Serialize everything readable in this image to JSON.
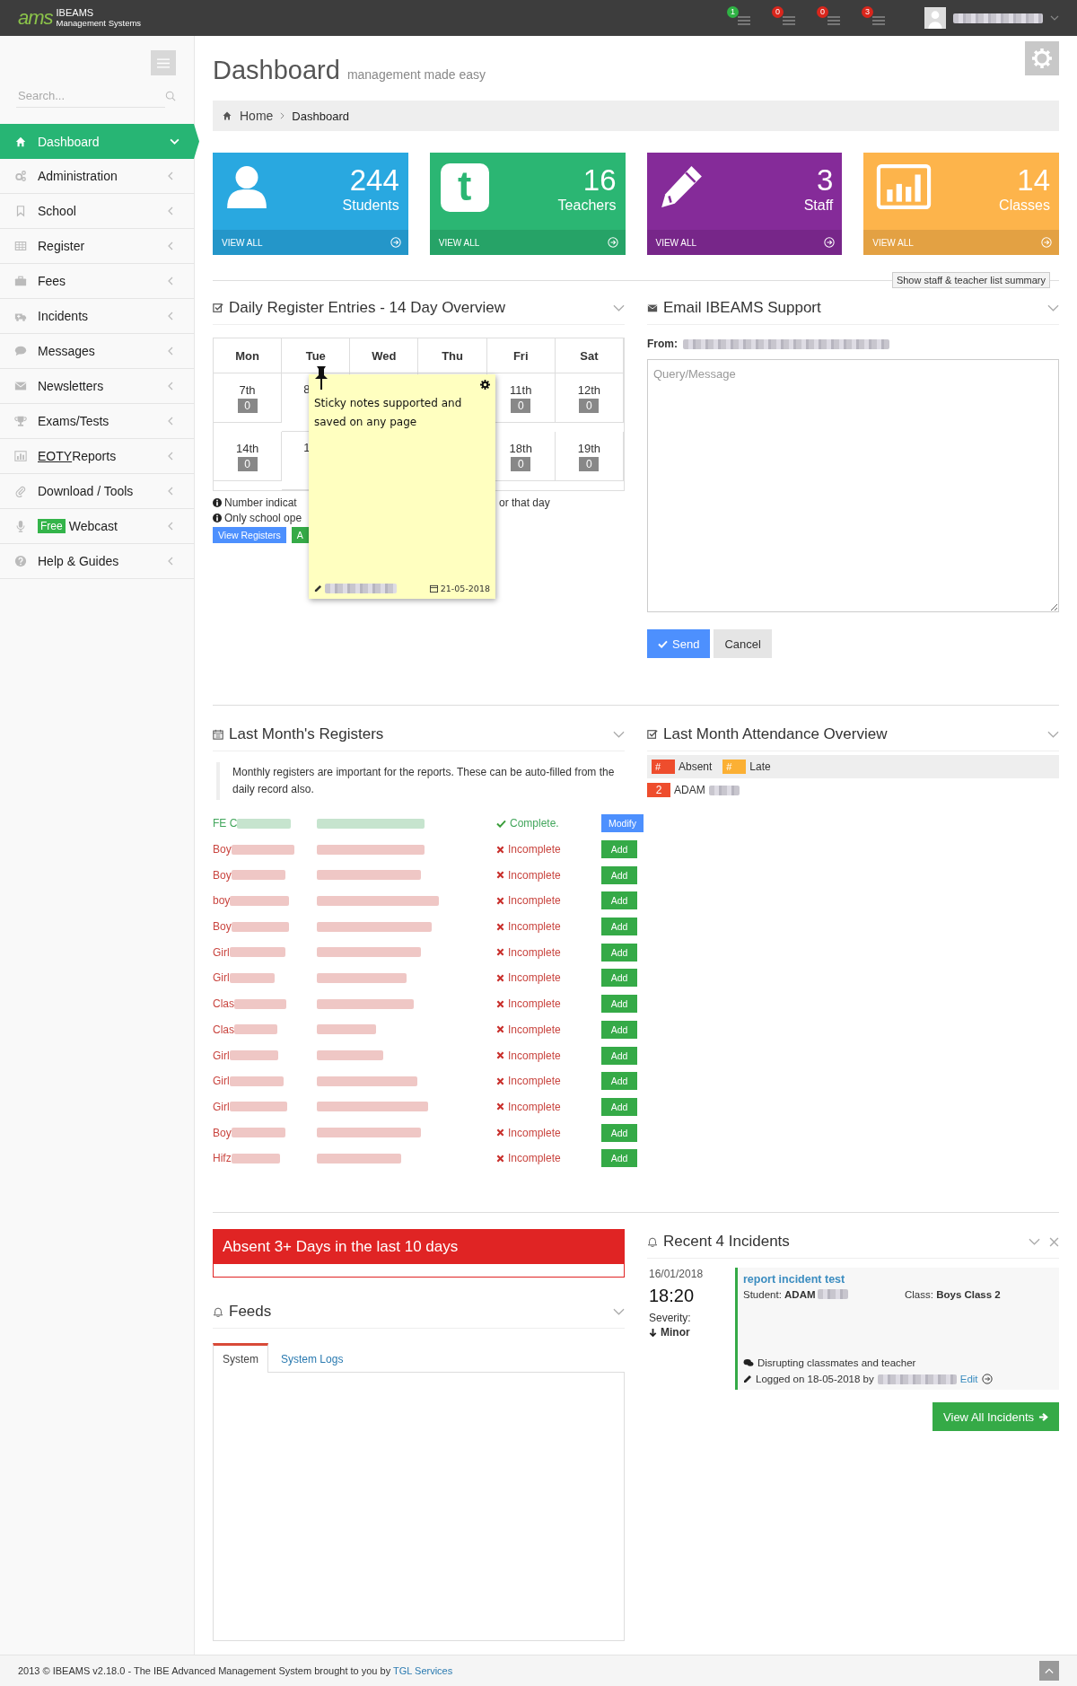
{
  "topbar": {
    "logo_mark": "ams",
    "brand": "IBEAMS",
    "tagline": "Management Systems",
    "alerts": [
      {
        "count": "1",
        "color": "#2fb344"
      },
      {
        "count": "0",
        "color": "#d9261c"
      },
      {
        "count": "0",
        "color": "#d9261c"
      },
      {
        "count": "3",
        "color": "#d9261c"
      }
    ]
  },
  "sidebar": {
    "search": {
      "placeholder": "Search..."
    },
    "items": [
      {
        "label": "Dashboard",
        "selected": true
      },
      {
        "label": "Administration",
        "selected": false
      },
      {
        "label": "School",
        "selected": false
      },
      {
        "label": "Register",
        "selected": false
      },
      {
        "label": "Fees",
        "selected": false
      },
      {
        "label": "Incidents",
        "selected": false
      },
      {
        "label": "Messages",
        "selected": false
      },
      {
        "label": "Newsletters",
        "selected": false
      },
      {
        "label": "Exams/Tests",
        "selected": false
      },
      {
        "label": "Reports",
        "abbr": "EOTY",
        "selected": false
      },
      {
        "label": "Download / Tools",
        "selected": false
      },
      {
        "label": "Webcast",
        "badge": "Free",
        "selected": false
      },
      {
        "label": "Help & Guides",
        "selected": false
      }
    ]
  },
  "page": {
    "title": "Dashboard",
    "subtitle": "management made easy",
    "breadcrumb": [
      "Home",
      "Dashboard"
    ]
  },
  "stats": [
    {
      "value": "244",
      "label": "Students",
      "link": "VIEW ALL",
      "color": "#29a8e0",
      "kind": "person"
    },
    {
      "value": "16",
      "label": "Teachers",
      "link": "VIEW ALL",
      "color": "#2bb673",
      "kind": "letter",
      "glyph": "t"
    },
    {
      "value": "3",
      "label": "Staff",
      "link": "VIEW ALL",
      "color": "#852b99",
      "kind": "pencil"
    },
    {
      "value": "14",
      "label": "Classes",
      "link": "VIEW ALL",
      "color": "#fdb44b",
      "kind": "chart"
    }
  ],
  "summary_button": "Show staff & teacher list summary",
  "daily": {
    "title": "Daily Register Entries - 14 Day Overview",
    "days": [
      "Mon",
      "Tue",
      "Wed",
      "Thu",
      "Fri",
      "Sat"
    ],
    "weeks": [
      {
        "before": [
          {
            "date": "7th",
            "count": "0",
            "covered": false
          },
          {
            "date": "8",
            "covered": true
          }
        ],
        "after": [
          {
            "date": "11th",
            "count": "0",
            "covered": false
          },
          {
            "date": "12th",
            "count": "0",
            "covered": false
          }
        ]
      },
      {
        "before": [
          {
            "date": "14th",
            "count": "0",
            "covered": false
          },
          {
            "date": "1",
            "covered": true
          }
        ],
        "after": [
          {
            "date": "18th",
            "count": "0",
            "covered": false
          },
          {
            "date": "19th",
            "count": "0",
            "covered": false
          }
        ]
      }
    ],
    "notes": [
      "Number indicat",
      "Only school ope"
    ],
    "note_tail": "or that day",
    "buttons": [
      {
        "label": "View Registers",
        "kind": "primary"
      },
      {
        "label": "A",
        "kind": "success"
      }
    ]
  },
  "sticky": {
    "text": "Sticky notes supported and saved on any page",
    "date": "21-05-2018"
  },
  "email": {
    "title": "Email IBEAMS Support",
    "from_label": "From:",
    "placeholder": "Query/Message",
    "send": "Send",
    "cancel": "Cancel"
  },
  "registers": {
    "title": "Last Month's Registers",
    "intro": "Monthly registers are important for the reports. These can be auto-filled from the daily record also.",
    "rows": [
      {
        "class": "FE C",
        "complete": true,
        "status": "Complete.",
        "action": "Modify"
      },
      {
        "class": "Boy",
        "complete": false,
        "status": "Incomplete",
        "action": "Add"
      },
      {
        "class": "Boy",
        "complete": false,
        "status": "Incomplete",
        "action": "Add"
      },
      {
        "class": "boy",
        "complete": false,
        "status": "Incomplete",
        "action": "Add"
      },
      {
        "class": "Boy",
        "complete": false,
        "status": "Incomplete",
        "action": "Add"
      },
      {
        "class": "Girl",
        "complete": false,
        "status": "Incomplete",
        "action": "Add"
      },
      {
        "class": "Girl",
        "complete": false,
        "status": "Incomplete",
        "action": "Add"
      },
      {
        "class": "Clas",
        "complete": false,
        "status": "Incomplete",
        "action": "Add"
      },
      {
        "class": "Clas",
        "complete": false,
        "status": "Incomplete",
        "action": "Add"
      },
      {
        "class": "Girl",
        "complete": false,
        "status": "Incomplete",
        "action": "Add"
      },
      {
        "class": "Girl",
        "complete": false,
        "status": "Incomplete",
        "action": "Add"
      },
      {
        "class": "Girl",
        "complete": false,
        "status": "Incomplete",
        "action": "Add"
      },
      {
        "class": "Boy",
        "complete": false,
        "status": "Incomplete",
        "action": "Add"
      },
      {
        "class": "Hifz",
        "complete": false,
        "status": "Incomplete",
        "action": "Add"
      }
    ]
  },
  "attendance": {
    "title": "Last Month Attendance Overview",
    "legend": [
      {
        "mark": "#",
        "label": "Absent",
        "color": "#ee4d2d"
      },
      {
        "mark": "#",
        "label": "Late",
        "color": "#fbb034"
      }
    ],
    "entries": [
      {
        "count": "2",
        "name": "ADAM",
        "color": "#ee4d2d"
      }
    ]
  },
  "absent": {
    "title": "Absent 3+ Days in the last 10 days"
  },
  "feeds": {
    "title": "Feeds",
    "tabs": [
      {
        "label": "System",
        "selected": true
      },
      {
        "label": "System Logs",
        "selected": false
      }
    ]
  },
  "incidents": {
    "title": "Recent 4 Incidents",
    "items": [
      {
        "date": "16/01/2018",
        "time": "18:20",
        "severity_label": "Severity:",
        "severity": "Minor",
        "title": "report incident test",
        "student_label": "Student:",
        "student": "ADAM",
        "class_label": "Class:",
        "class": "Boys Class 2",
        "description": "Disrupting classmates and teacher",
        "logged": "Logged on 18-05-2018 by",
        "edit": "Edit"
      }
    ],
    "view_all": "View All Incidents"
  },
  "footer": {
    "text": "2013 © IBEAMS v2.18.0 - The IBE Advanced Management System brought to you by",
    "link": "TGL Services"
  }
}
